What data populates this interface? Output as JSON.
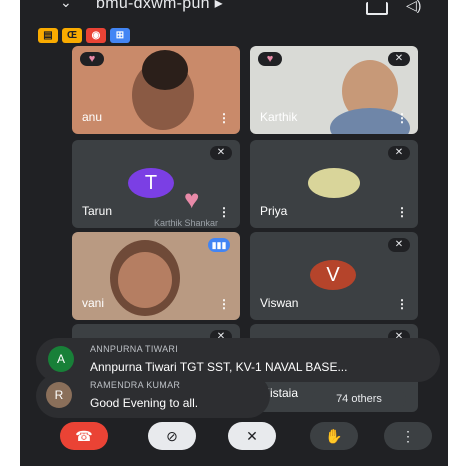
{
  "meeting": {
    "code": "bmu-dxwm-puh ▸"
  },
  "status_icons": [
    {
      "name": "raise-hand-status-icon",
      "glyph": "▤",
      "color": "#f9ab00"
    },
    {
      "name": "captions-status-icon",
      "glyph": "Œ",
      "color": "#f9ab00"
    },
    {
      "name": "record-status-icon",
      "glyph": "◉",
      "color": "#ea4335"
    },
    {
      "name": "people-status-icon",
      "glyph": "⊞",
      "color": "#4285f4"
    }
  ],
  "participants": [
    {
      "name": "anu"
    },
    {
      "name": "Karthik"
    },
    {
      "name": "Tarun",
      "initial": "T",
      "initial_color": "#7b3fe4"
    },
    {
      "name": "Priya"
    },
    {
      "name": "vani"
    },
    {
      "name": "Viswan",
      "initial": "V",
      "initial_color": "#b5442b"
    },
    {
      "name": "Kistaia"
    }
  ],
  "overlay_label": "Karthik Shankar",
  "chat": [
    {
      "initial": "A",
      "avatar_color": "#188038",
      "sender": "ANNPURNA TIWARI",
      "message": "Annpurna Tiwari TGT SST, KV-1 NAVAL BASE..."
    },
    {
      "initial": "R",
      "avatar_color": "#8a6f5a",
      "sender": "RAMENDRA KUMAR",
      "message": "Good Evening to all."
    }
  ],
  "others_label": "74 others",
  "controls": {
    "end_call": "end-call-icon",
    "camera": "camera-off-icon",
    "mic": "mic-off-icon",
    "hand": "raise-hand-icon",
    "more": "more-options-icon"
  }
}
